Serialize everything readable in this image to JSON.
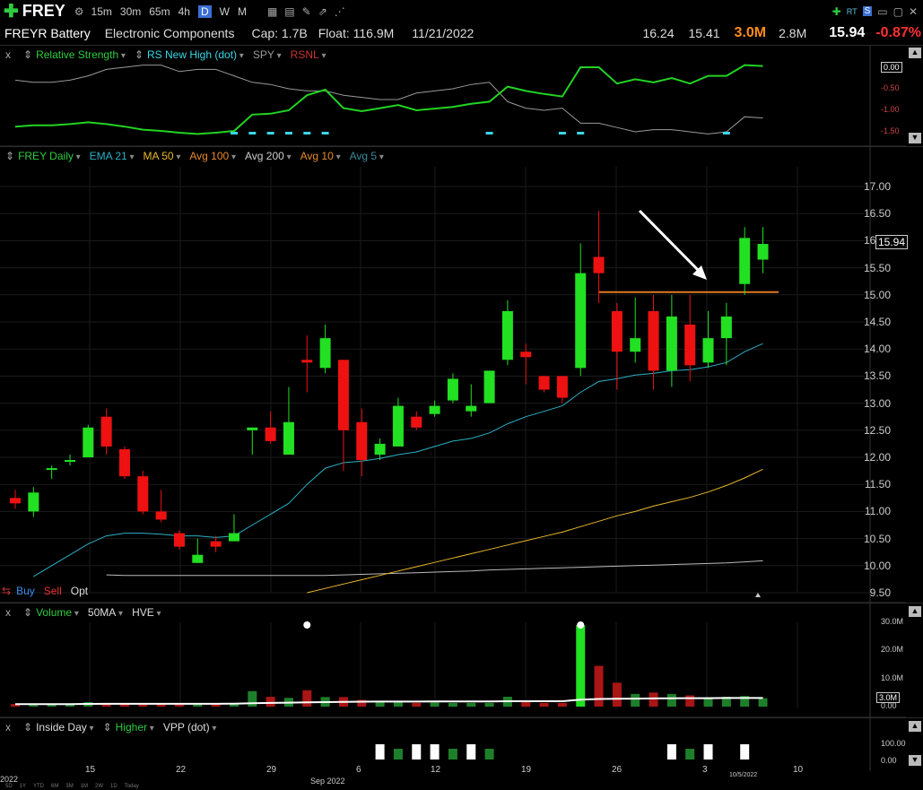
{
  "toolbar": {
    "ticker": "FREY",
    "timeframes": [
      "15m",
      "30m",
      "65m",
      "4h",
      "D",
      "W",
      "M"
    ],
    "active_timeframe": "D"
  },
  "info": {
    "name": "FREYR Battery",
    "industry": "Electronic Components",
    "cap": "Cap: 1.7B",
    "float": "Float: 116.9M",
    "date": "11/21/2022",
    "high": "16.24",
    "low": "15.41",
    "volume": "3.0M",
    "avg_volume": "2.8M",
    "price": "15.94",
    "change": "-0.87%"
  },
  "rs_pane": {
    "close": "x",
    "labels": [
      "Relative Strength",
      "RS New High (dot)",
      "SPY",
      "RSNL"
    ],
    "axis": [
      "0.00",
      "-0.50",
      "-1.00",
      "-1.50"
    ]
  },
  "price_pane": {
    "labels": [
      "FREY Daily",
      "EMA 21",
      "MA 50",
      "Avg 100",
      "Avg 200",
      "Avg 10",
      "Avg 5"
    ],
    "axis": [
      "17.00",
      "16.50",
      "16.00",
      "15.50",
      "15.00",
      "14.50",
      "14.00",
      "13.50",
      "13.00",
      "12.50",
      "12.00",
      "11.50",
      "11.00",
      "10.50",
      "10.00",
      "9.50"
    ],
    "last_price": "15.94",
    "trade": [
      "Buy",
      "Sell",
      "Opt"
    ]
  },
  "volume_pane": {
    "close": "x",
    "labels": [
      "Volume",
      "50MA",
      "HVE"
    ],
    "axis": [
      "30.0M",
      "20.0M",
      "10.0M",
      "0.00"
    ],
    "last": "3.0M"
  },
  "indicator_pane": {
    "close": "x",
    "labels": [
      "Inside Day",
      "Higher",
      "VPP (dot)"
    ],
    "axis": [
      "100.00",
      "0.00"
    ]
  },
  "x_axis": {
    "labels": [
      "15",
      "22",
      "29",
      "6",
      "12",
      "19",
      "26",
      "3",
      "10"
    ],
    "month": "Sep 2022",
    "left_year": "2022",
    "cursor_date": "10/5/2022",
    "ranges": [
      "5D",
      "1Y",
      "YTD",
      "6M",
      "3M",
      "1M",
      "2W",
      "1D",
      "Today"
    ]
  },
  "chart_data": {
    "type": "candlestick",
    "ylim": [
      9.5,
      17.0
    ],
    "candles": [
      {
        "o": 11.25,
        "h": 11.4,
        "l": 11.05,
        "c": 11.15
      },
      {
        "o": 11.0,
        "h": 11.45,
        "l": 10.9,
        "c": 11.35
      },
      {
        "o": 11.8,
        "h": 11.85,
        "l": 11.6,
        "c": 11.8
      },
      {
        "o": 11.95,
        "h": 12.05,
        "l": 11.85,
        "c": 11.95
      },
      {
        "o": 12.0,
        "h": 12.6,
        "l": 12.0,
        "c": 12.55
      },
      {
        "o": 12.75,
        "h": 12.9,
        "l": 12.05,
        "c": 12.2
      },
      {
        "o": 12.15,
        "h": 12.2,
        "l": 11.6,
        "c": 11.65
      },
      {
        "o": 11.65,
        "h": 11.75,
        "l": 10.95,
        "c": 11.0
      },
      {
        "o": 11.0,
        "h": 11.4,
        "l": 10.8,
        "c": 10.85
      },
      {
        "o": 10.6,
        "h": 10.65,
        "l": 10.3,
        "c": 10.35
      },
      {
        "o": 10.05,
        "h": 10.5,
        "l": 10.05,
        "c": 10.2
      },
      {
        "o": 10.45,
        "h": 10.55,
        "l": 10.25,
        "c": 10.35
      },
      {
        "o": 10.45,
        "h": 10.95,
        "l": 10.45,
        "c": 10.6
      },
      {
        "o": 12.5,
        "h": 12.55,
        "l": 12.05,
        "c": 12.55
      },
      {
        "o": 12.55,
        "h": 12.85,
        "l": 12.25,
        "c": 12.3
      },
      {
        "o": 12.05,
        "h": 13.3,
        "l": 12.05,
        "c": 12.65
      },
      {
        "o": 13.8,
        "h": 14.25,
        "l": 13.2,
        "c": 13.75
      },
      {
        "o": 13.65,
        "h": 14.45,
        "l": 13.55,
        "c": 14.2
      },
      {
        "o": 13.8,
        "h": 13.8,
        "l": 11.75,
        "c": 12.5
      },
      {
        "o": 12.65,
        "h": 12.9,
        "l": 11.65,
        "c": 11.95
      },
      {
        "o": 12.05,
        "h": 12.35,
        "l": 11.95,
        "c": 12.25
      },
      {
        "o": 12.2,
        "h": 13.1,
        "l": 12.2,
        "c": 12.95
      },
      {
        "o": 12.75,
        "h": 12.85,
        "l": 12.5,
        "c": 12.55
      },
      {
        "o": 12.8,
        "h": 13.05,
        "l": 12.75,
        "c": 12.95
      },
      {
        "o": 13.05,
        "h": 13.55,
        "l": 13.0,
        "c": 13.45
      },
      {
        "o": 12.85,
        "h": 13.35,
        "l": 12.75,
        "c": 12.95
      },
      {
        "o": 13.0,
        "h": 13.6,
        "l": 13.0,
        "c": 13.6
      },
      {
        "o": 13.8,
        "h": 14.9,
        "l": 13.7,
        "c": 14.7
      },
      {
        "o": 13.95,
        "h": 14.1,
        "l": 13.35,
        "c": 13.85
      },
      {
        "o": 13.5,
        "h": 13.5,
        "l": 13.2,
        "c": 13.25
      },
      {
        "o": 13.5,
        "h": 13.5,
        "l": 13.0,
        "c": 13.1
      },
      {
        "o": 13.65,
        "h": 15.95,
        "l": 13.5,
        "c": 15.4
      },
      {
        "o": 15.7,
        "h": 16.55,
        "l": 14.85,
        "c": 15.4
      },
      {
        "o": 14.7,
        "h": 14.85,
        "l": 13.25,
        "c": 13.95
      },
      {
        "o": 13.95,
        "h": 14.95,
        "l": 13.75,
        "c": 14.2
      },
      {
        "o": 14.7,
        "h": 15.0,
        "l": 13.25,
        "c": 13.6
      },
      {
        "o": 13.6,
        "h": 15.0,
        "l": 13.3,
        "c": 14.6
      },
      {
        "o": 14.45,
        "h": 15.0,
        "l": 13.4,
        "c": 13.7
      },
      {
        "o": 13.75,
        "h": 14.7,
        "l": 13.65,
        "c": 14.2
      },
      {
        "o": 14.2,
        "h": 14.85,
        "l": 13.7,
        "c": 14.6
      },
      {
        "o": 15.2,
        "h": 16.25,
        "l": 15.0,
        "c": 16.05
      },
      {
        "o": 15.65,
        "h": 16.25,
        "l": 15.4,
        "c": 15.94
      }
    ],
    "ema21": [
      null,
      9.8,
      10.0,
      10.2,
      10.4,
      10.55,
      10.6,
      10.6,
      10.58,
      10.55,
      10.55,
      10.52,
      10.55,
      10.75,
      10.95,
      11.15,
      11.5,
      11.8,
      11.9,
      11.93,
      11.98,
      12.05,
      12.1,
      12.2,
      12.3,
      12.35,
      12.45,
      12.62,
      12.75,
      12.85,
      12.95,
      13.2,
      13.4,
      13.45,
      13.52,
      13.55,
      13.6,
      13.62,
      13.67,
      13.75,
      13.95,
      14.1
    ],
    "ma50": [
      null,
      null,
      null,
      null,
      null,
      null,
      null,
      null,
      null,
      null,
      null,
      null,
      null,
      null,
      null,
      null,
      9.5,
      9.58,
      9.66,
      9.74,
      9.82,
      9.9,
      9.98,
      10.06,
      10.14,
      10.22,
      10.3,
      10.38,
      10.46,
      10.54,
      10.62,
      10.72,
      10.82,
      10.92,
      11.0,
      11.1,
      11.18,
      11.26,
      11.36,
      11.48,
      11.62,
      11.78
    ],
    "avg200": [
      null,
      null,
      null,
      null,
      null,
      9.83,
      9.82,
      9.82,
      9.82,
      9.82,
      9.82,
      9.82,
      9.82,
      9.82,
      9.82,
      9.82,
      9.82,
      9.82,
      9.83,
      9.84,
      9.85,
      9.86,
      9.87,
      9.88,
      9.89,
      9.9,
      9.92,
      9.93,
      9.94,
      9.95,
      9.96,
      9.97,
      9.98,
      9.99,
      10.0,
      10.01,
      10.02,
      10.03,
      10.04,
      10.05,
      10.07,
      10.09
    ],
    "resistance": 15.05,
    "volume_millions": [
      0.9,
      0.6,
      0.9,
      0.8,
      1.6,
      1.0,
      0.8,
      0.7,
      0.8,
      0.7,
      0.7,
      0.7,
      1.0,
      5.5,
      3.5,
      3.1,
      5.8,
      3.4,
      3.4,
      2.4,
      1.6,
      1.6,
      1.3,
      1.5,
      1.3,
      1.3,
      1.3,
      3.5,
      1.7,
      1.3,
      1.3,
      29.0,
      14.5,
      8.5,
      4.5,
      5.0,
      4.5,
      4.0,
      3.3,
      3.5,
      3.8,
      3.0
    ],
    "volume_ma": [
      0.9,
      0.9,
      0.9,
      0.9,
      0.95,
      1.0,
      1.0,
      1.0,
      1.0,
      1.0,
      1.0,
      1.0,
      1.05,
      1.2,
      1.3,
      1.4,
      1.5,
      1.6,
      1.7,
      1.75,
      1.8,
      1.8,
      1.8,
      1.85,
      1.85,
      1.85,
      1.85,
      1.9,
      1.9,
      1.9,
      1.9,
      2.5,
      2.7,
      2.8,
      2.85,
      2.9,
      2.95,
      3.0,
      3.0,
      3.05,
      3.05,
      3.05
    ],
    "relative_strength": [
      -1.38,
      -1.35,
      -1.35,
      -1.32,
      -1.28,
      -1.32,
      -1.38,
      -1.45,
      -1.48,
      -1.52,
      -1.55,
      -1.52,
      -1.48,
      -1.1,
      -1.08,
      -1.0,
      -0.65,
      -0.52,
      -0.95,
      -1.02,
      -0.95,
      -0.88,
      -1.0,
      -0.96,
      -0.92,
      -0.85,
      -0.8,
      -0.45,
      -0.55,
      -0.62,
      -0.68,
      0.0,
      0.0,
      -0.38,
      -0.28,
      -0.35,
      -0.25,
      -0.38,
      -0.2,
      -0.2,
      0.05,
      0.03
    ],
    "spy_ratio": [
      -0.3,
      -0.35,
      -0.35,
      -0.3,
      -0.2,
      -0.05,
      0.0,
      0.05,
      0.05,
      -0.1,
      -0.05,
      -0.05,
      -0.2,
      -0.35,
      -0.4,
      -0.5,
      -0.55,
      -0.55,
      -0.65,
      -0.7,
      -0.75,
      -0.75,
      -0.6,
      -0.55,
      -0.5,
      -0.4,
      -0.35,
      -0.8,
      -0.95,
      -1.0,
      -0.95,
      -1.3,
      -1.3,
      -1.4,
      -1.5,
      -1.45,
      -1.45,
      -1.5,
      -1.55,
      -1.5,
      -1.15,
      -1.18
    ],
    "rs_new_high_days": [
      12,
      13,
      14,
      15,
      16,
      17,
      26,
      30,
      31,
      39
    ],
    "inside_day": [
      0,
      0,
      0,
      0,
      0,
      0,
      0,
      0,
      0,
      0,
      0,
      0,
      0,
      0,
      0,
      0,
      0,
      0,
      0,
      0,
      1,
      0,
      1,
      1,
      0,
      1,
      0,
      0,
      0,
      0,
      0,
      0,
      0,
      0,
      0,
      0,
      1,
      0,
      1,
      0,
      1,
      0
    ],
    "higher": [
      0,
      0,
      0,
      0,
      0,
      0,
      0,
      0,
      0,
      0,
      0,
      0,
      0,
      0,
      0,
      0,
      0,
      0,
      0,
      0,
      0,
      1,
      0,
      0,
      1,
      0,
      1,
      0,
      0,
      0,
      0,
      0,
      0,
      0,
      0,
      0,
      0,
      1,
      0,
      0,
      0,
      0
    ],
    "vpp_dot_days": [
      16,
      31
    ],
    "last_highlight_index": 41
  }
}
